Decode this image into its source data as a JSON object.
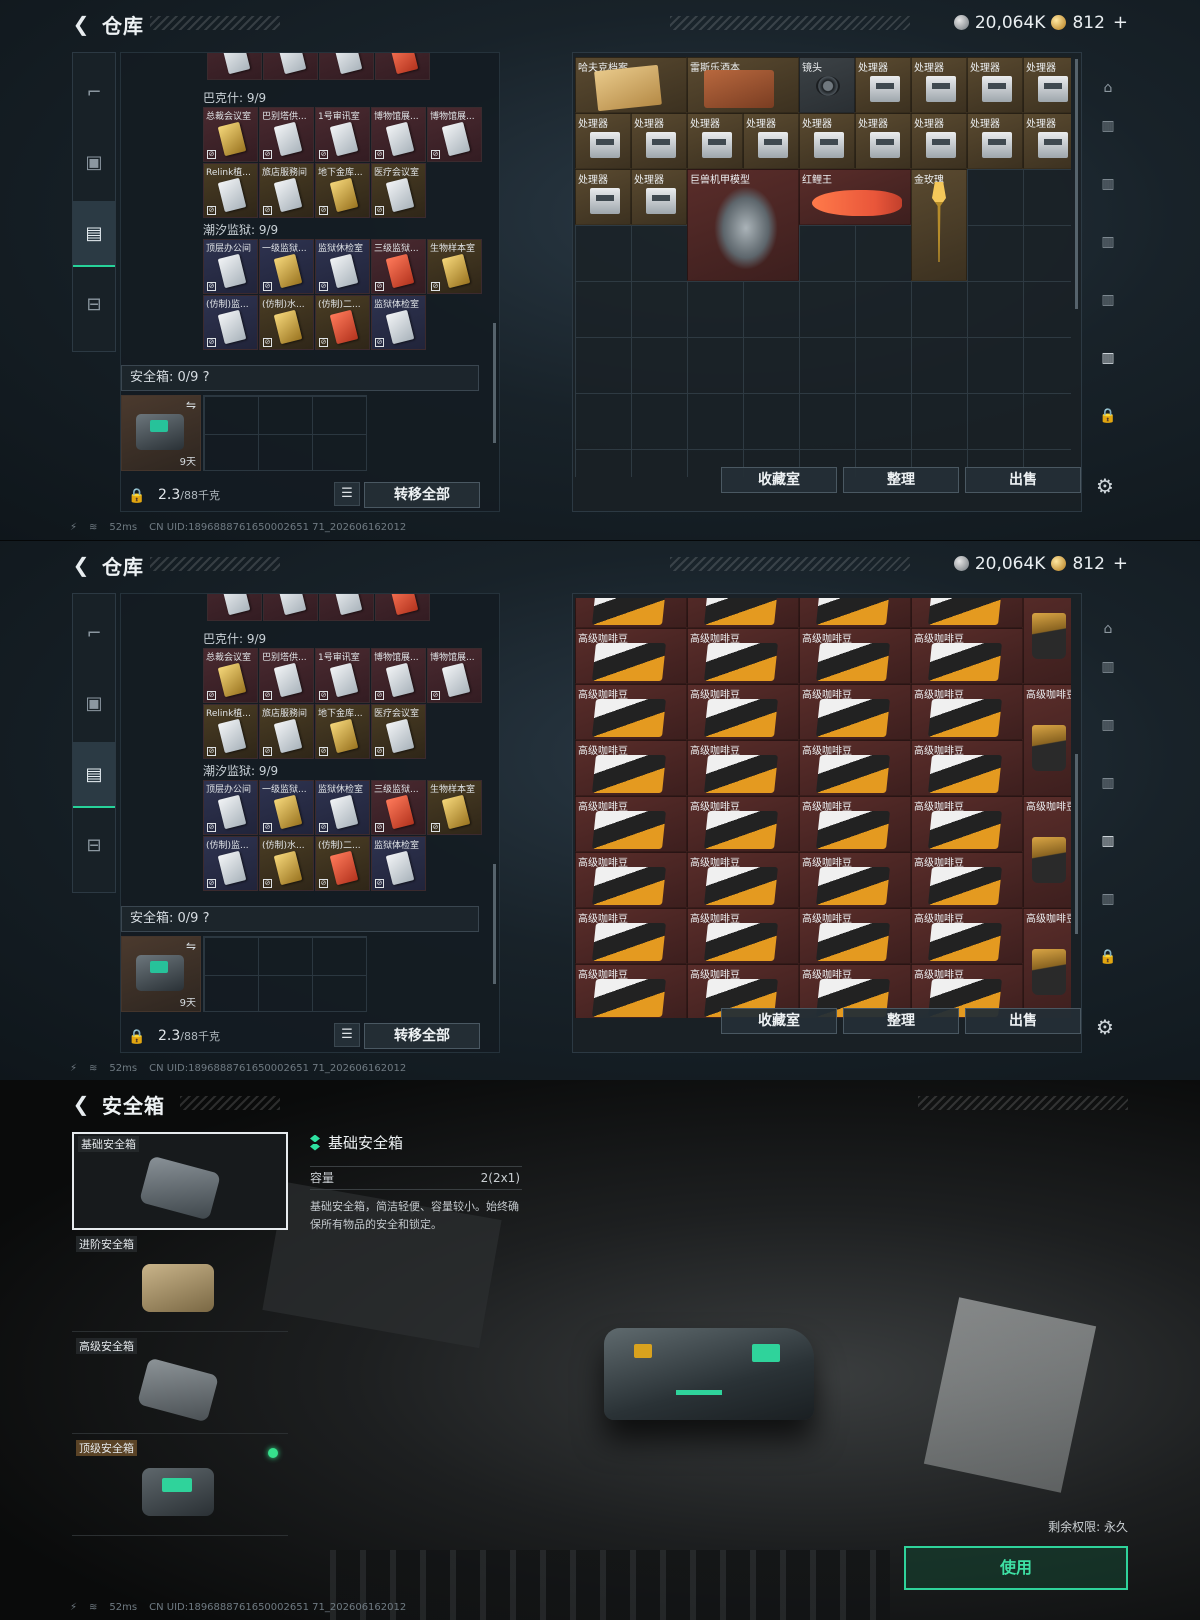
{
  "common": {
    "title": "仓库",
    "currency1": "20,064K",
    "currency2": "812",
    "plus": "+",
    "weight_value": "2.3",
    "weight_max": "/88千克",
    "transfer_all": "转移全部",
    "ping": "52ms",
    "uid": "CN UID:1896888761650002651 71_202606162012",
    "status_icon_text": "⚡",
    "wifi": "≋"
  },
  "left": {
    "section_bakesh": "巴克什: 9/9",
    "section_tide": "潮汐监狱: 9/9",
    "safe_label": "安全箱: 0/9 ?",
    "safe_days": "9天",
    "row1": [
      "总裁会议室",
      "巴别塔供...",
      "1号审讯室",
      "博物馆展...",
      "博物馆展..."
    ],
    "row2": [
      "Relink植...",
      "旅店服務间",
      "地下金库...",
      "医疗会议室"
    ],
    "row3": [
      "顶层办公间",
      "一级监狱...",
      "监狱休检室",
      "三级监狱...",
      "生物样本室"
    ],
    "row4": [
      "(仿制)监...",
      "(仿制)水...",
      "(仿制)二...",
      "监狱体检室"
    ]
  },
  "right_top": {
    "items": {
      "hafu": "哈夫克档案",
      "leisi": "雷斯乐酒本",
      "lens": "镜头",
      "processor": "处理器",
      "mech": "巨兽机甲模型",
      "fish": "红鲤王",
      "rose": "金玫瑰"
    }
  },
  "right_bottom": {
    "coffee": "高级咖啡豆"
  },
  "right_buttons": {
    "collection": "收藏室",
    "organize": "整理",
    "sell": "出售"
  },
  "safe_screen": {
    "title": "安全箱",
    "list": [
      "基础安全箱",
      "进阶安全箱",
      "高级安全箱",
      "顶级安全箱"
    ],
    "detail_title": "基础安全箱",
    "capacity_label": "容量",
    "capacity_value": "2(2x1)",
    "description": "基础安全箱，简洁轻便、容量较小。始终确保所有物品的安全和锁定。",
    "remaining": "剩余权限: 永久",
    "use_button": "使用"
  },
  "icons": [
    "back-arrow-icon",
    "pistol-icon",
    "backpack-icon",
    "clipboard-icon",
    "briefcase-icon",
    "lock-icon",
    "list-icon",
    "gear-icon",
    "swap-icon"
  ],
  "colors": {
    "accent": "#2fd39b",
    "active_tab": "#27d29a"
  }
}
